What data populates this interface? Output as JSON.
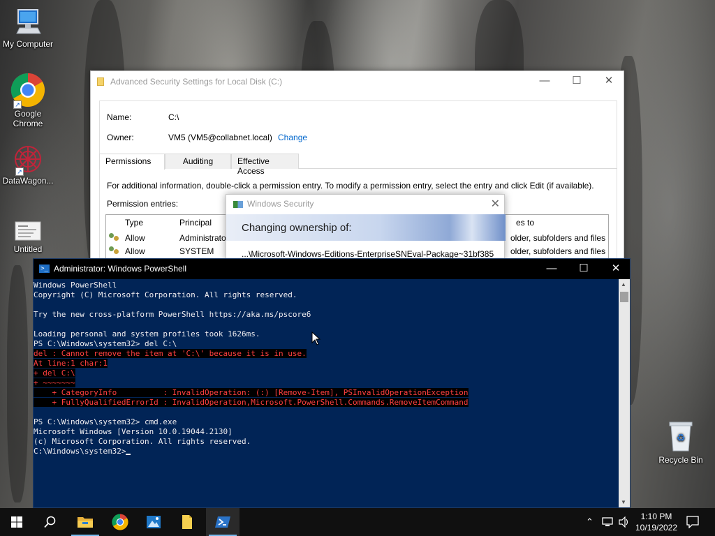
{
  "desktop": {
    "icons": [
      {
        "label": "My Computer",
        "icon": "computer-icon"
      },
      {
        "label": "Google Chrome",
        "icon": "chrome-icon"
      },
      {
        "label": "DataWagon...",
        "icon": "datawagon-icon"
      },
      {
        "label": "Untitled",
        "icon": "document-icon"
      },
      {
        "label": "Recycle Bin",
        "icon": "recycle-bin-icon"
      }
    ]
  },
  "security_window": {
    "title": "Advanced Security Settings for Local Disk (C:)",
    "name_label": "Name:",
    "name_value": "C:\\",
    "owner_label": "Owner:",
    "owner_value": "VM5 (VM5@collabnet.local)",
    "change_link": "Change",
    "tabs": [
      {
        "label": "Permissions",
        "active": true
      },
      {
        "label": "Auditing",
        "active": false
      },
      {
        "label": "Effective Access",
        "active": false
      }
    ],
    "info_text": "For additional information, double-click a permission entry. To modify a permission entry, select the entry and click Edit (if available).",
    "entries_label": "Permission entries:",
    "columns": {
      "type": "Type",
      "principal": "Principal",
      "applies": "es to"
    },
    "rows": [
      {
        "type": "Allow",
        "principal": "Administrators (VM",
        "applies": "older, subfolders and files"
      },
      {
        "type": "Allow",
        "principal": "SYSTEM",
        "applies": "older, subfolders and files"
      }
    ]
  },
  "security_dialog": {
    "title": "Windows Security",
    "heading": "Changing ownership of:",
    "path": "...\\Microsoft-Windows-Editions-EnterpriseSNEval-Package~31bf385"
  },
  "powershell": {
    "title": "Administrator: Windows PowerShell",
    "lines": [
      {
        "text": "Windows PowerShell",
        "error": false
      },
      {
        "text": "Copyright (C) Microsoft Corporation. All rights reserved.",
        "error": false
      },
      {
        "text": "",
        "error": false
      },
      {
        "text": "Try the new cross-platform PowerShell https://aka.ms/pscore6",
        "error": false
      },
      {
        "text": "",
        "error": false
      },
      {
        "text": "Loading personal and system profiles took 1626ms.",
        "error": false
      },
      {
        "text": "PS C:\\Windows\\system32> del C:\\",
        "error": false
      },
      {
        "text": "del : Cannot remove the item at 'C:\\' because it is in use.",
        "error": true
      },
      {
        "text": "At line:1 char:1",
        "error": true
      },
      {
        "text": "+ del C:\\",
        "error": true
      },
      {
        "text": "+ ~~~~~~~",
        "error": true
      },
      {
        "text": "    + CategoryInfo          : InvalidOperation: (:) [Remove-Item], PSInvalidOperationException",
        "error": true
      },
      {
        "text": "    + FullyQualifiedErrorId : InvalidOperation,Microsoft.PowerShell.Commands.RemoveItemCommand",
        "error": true
      },
      {
        "text": "",
        "error": false
      },
      {
        "text": "PS C:\\Windows\\system32> cmd.exe",
        "error": false
      },
      {
        "text": "Microsoft Windows [Version 10.0.19044.2130]",
        "error": false
      },
      {
        "text": "(c) Microsoft Corporation. All rights reserved.",
        "error": false
      },
      {
        "text": "C:\\Windows\\system32>",
        "error": false,
        "cursor": true
      }
    ]
  },
  "taskbar": {
    "time": "1:10 PM",
    "date": "10/19/2022",
    "pinned": [
      "start-icon",
      "search-icon",
      "file-explorer-icon",
      "chrome-icon",
      "photos-icon",
      "notepad-icon",
      "powershell-icon"
    ],
    "active": "powershell-icon"
  },
  "colors": {
    "powershell_bg": "#012456",
    "error_text": "#ff4040",
    "link": "#0066cc",
    "taskbar": "#101010"
  }
}
